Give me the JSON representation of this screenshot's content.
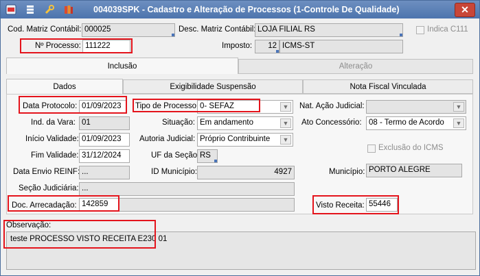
{
  "window": {
    "title": "004039SPK - Cadastro e Alteração de Processos (1-Controle De Qualidade)",
    "close_label": "✕"
  },
  "header": {
    "cod_matriz_label": "Cod. Matriz Contábil:",
    "cod_matriz_value": "000025",
    "desc_matriz_label": "Desc. Matriz Contábil:",
    "desc_matriz_value": "LOJA FILIAL RS",
    "indica_label": "Indica C111",
    "n_processo_label": "Nº Processo:",
    "n_processo_value": "111222",
    "imposto_label": "Imposto:",
    "imposto_code": "12",
    "imposto_desc": "ICMS-ST"
  },
  "tabs": {
    "inclusao": "Inclusão",
    "alteracao": "Alteração"
  },
  "subtabs": {
    "dados": "Dados",
    "exigibilidade": "Exigibilidade Suspensão",
    "nota_fiscal": "Nota Fiscal Vinculada"
  },
  "form": {
    "data_protocolo_label": "Data Protocolo:",
    "data_protocolo_value": "01/09/2023",
    "tipo_processo_label": "Tipo de Processo:",
    "tipo_processo_value": "0- SEFAZ",
    "nat_acao_label": "Nat. Ação Judicial:",
    "nat_acao_value": "",
    "ind_vara_label": "Ind. da Vara:",
    "ind_vara_value": "01",
    "situacao_label": "Situação:",
    "situacao_value": "Em andamento",
    "ato_label": "Ato Concessório:",
    "ato_value": "08 - Termo de Acordo",
    "inicio_label": "Início Validade:",
    "inicio_value": "01/09/2023",
    "autoria_label": "Autoria Judicial:",
    "autoria_value": "Próprio Contribuinte",
    "fim_label": "Fim Validade:",
    "fim_value": "31/12/2024",
    "uf_label": "UF da Seção:",
    "uf_value": "RS",
    "exclusao_label": "Exclusão do ICMS",
    "envio_label": "Data Envio REINF:",
    "envio_value": "...",
    "id_municipio_label": "ID Município:",
    "id_municipio_value": "4927",
    "municipio_label": "Município:",
    "municipio_value": "PORTO ALEGRE",
    "secao_label": "Seção Judiciária:",
    "secao_value": "...",
    "doc_label": "Doc. Arrecadação:",
    "doc_value": "142859",
    "visto_label": "Visto Receita:",
    "visto_value": "55446"
  },
  "observacao": {
    "label": "Observação:",
    "value": "teste PROCESSO VISTO RECEITA E230 01"
  },
  "colors": {
    "titlebar": "#4d74ad",
    "highlight": "#e4131b"
  }
}
